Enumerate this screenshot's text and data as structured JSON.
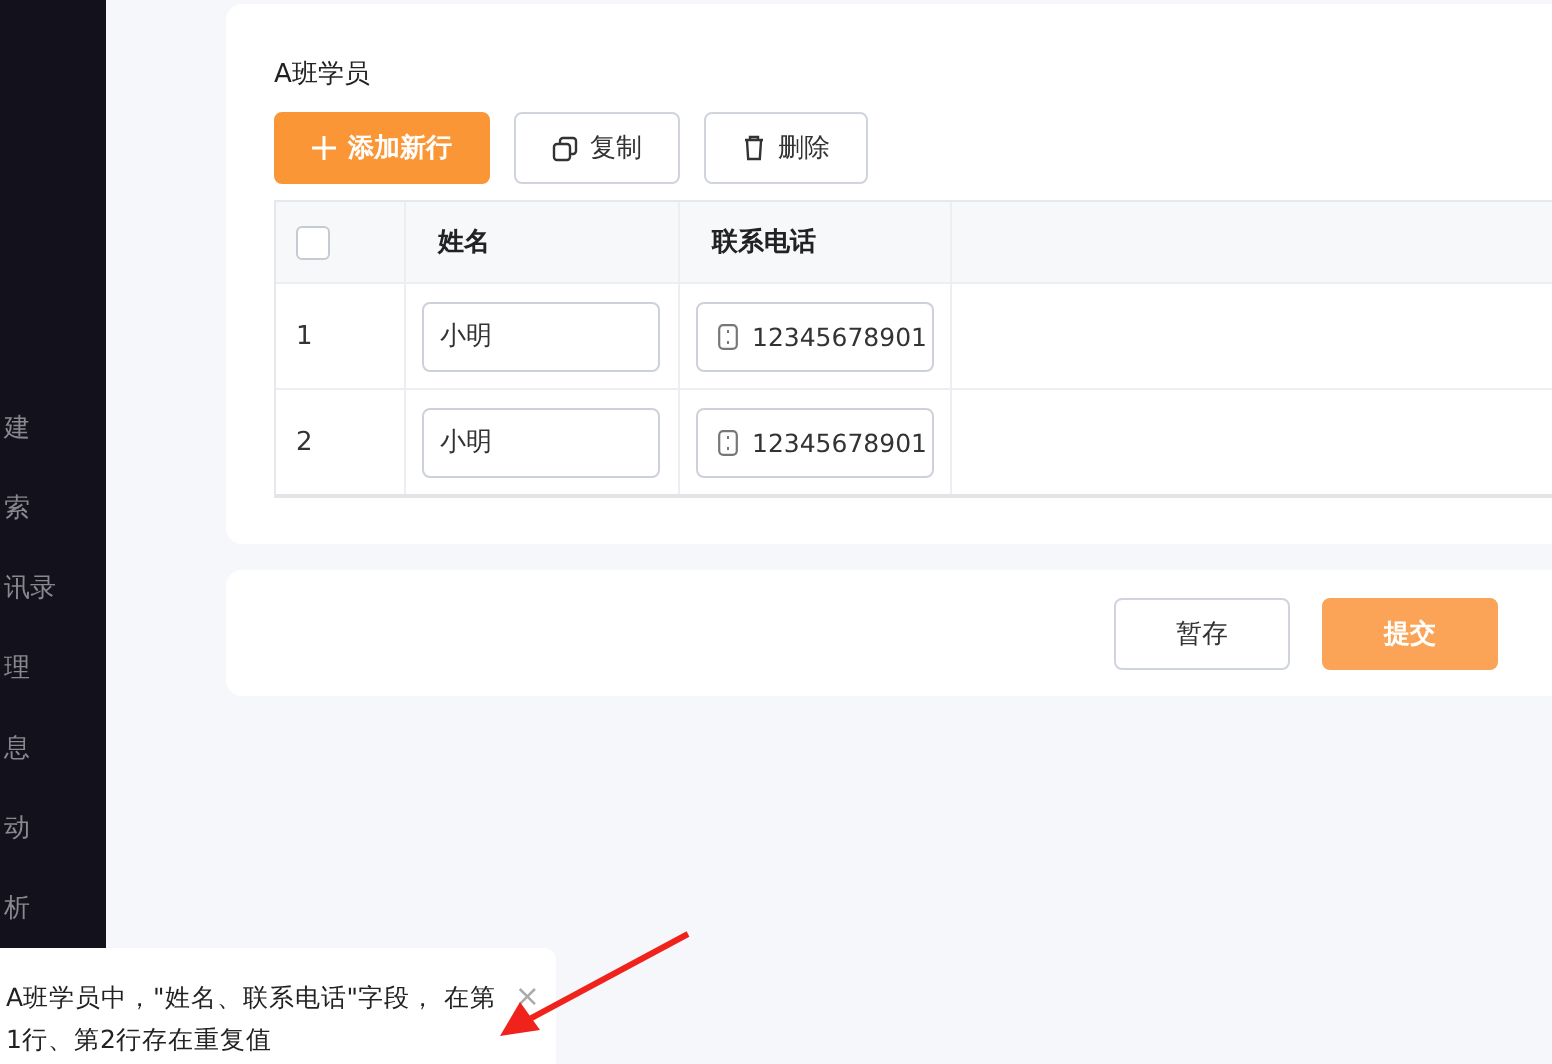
{
  "sidebar": {
    "items": [
      "建",
      "索",
      "讯录",
      "理",
      "息",
      "动",
      "析"
    ]
  },
  "section": {
    "title": "A班学员"
  },
  "toolbar": [
    {
      "kind": "add",
      "label": "添加新行"
    },
    {
      "kind": "copy",
      "label": "复制"
    },
    {
      "kind": "delete",
      "label": "删除"
    }
  ],
  "table": {
    "select_all": {
      "checked": false
    },
    "columns": [
      "姓名",
      "联系电话"
    ],
    "rows": [
      {
        "index": "1",
        "name": "小明",
        "phone": "12345678901"
      },
      {
        "index": "2",
        "name": "小明",
        "phone": "12345678901"
      }
    ]
  },
  "actions": [
    {
      "kind": "secondary",
      "label": "暂存"
    },
    {
      "kind": "primary",
      "label": "提交"
    }
  ],
  "notification": {
    "message": "A班学员中，\"姓名、联系电话\"字段， 在第1行、第2行存在重复值",
    "close": "×"
  }
}
